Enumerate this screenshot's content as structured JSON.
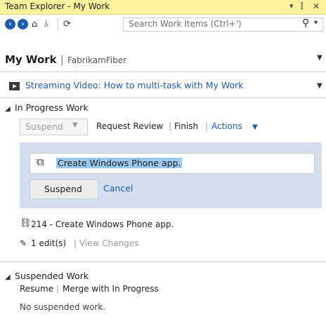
{
  "window": {
    "title": "Team Explorer - My Work",
    "controls": [
      "▾",
      "⫿",
      "✕"
    ]
  },
  "toolbar": {
    "search_placeholder": "Search Work Items (Ctrl+')"
  },
  "header": {
    "title": "My Work",
    "separator": "|",
    "project": "FabrikamFiber"
  },
  "video": {
    "link": "Streaming Video: How to multi-task with My Work"
  },
  "in_progress": {
    "title": "In Progress Work",
    "suspend_dropdown": "Suspend",
    "request_review": "Request Review",
    "finish": "Finish",
    "actions": "Actions",
    "separator": "|",
    "edit_item_text": "Create Windows Phone app.",
    "suspend_button": "Suspend",
    "cancel_link": "Cancel",
    "work_item": "214 - Create Windows Phone app.",
    "edits": "1 edit(s)",
    "view_changes": "View Changes"
  },
  "suspended": {
    "title": "Suspended Work",
    "resume": "Resume",
    "merge": "Merge with In Progress",
    "separator": "|",
    "empty_message": "No suspended work."
  },
  "colors": {
    "title_bar": "#fff29d",
    "link": "#1e5bb0",
    "panel": "#d5deef",
    "selection": "#99c9ef"
  }
}
